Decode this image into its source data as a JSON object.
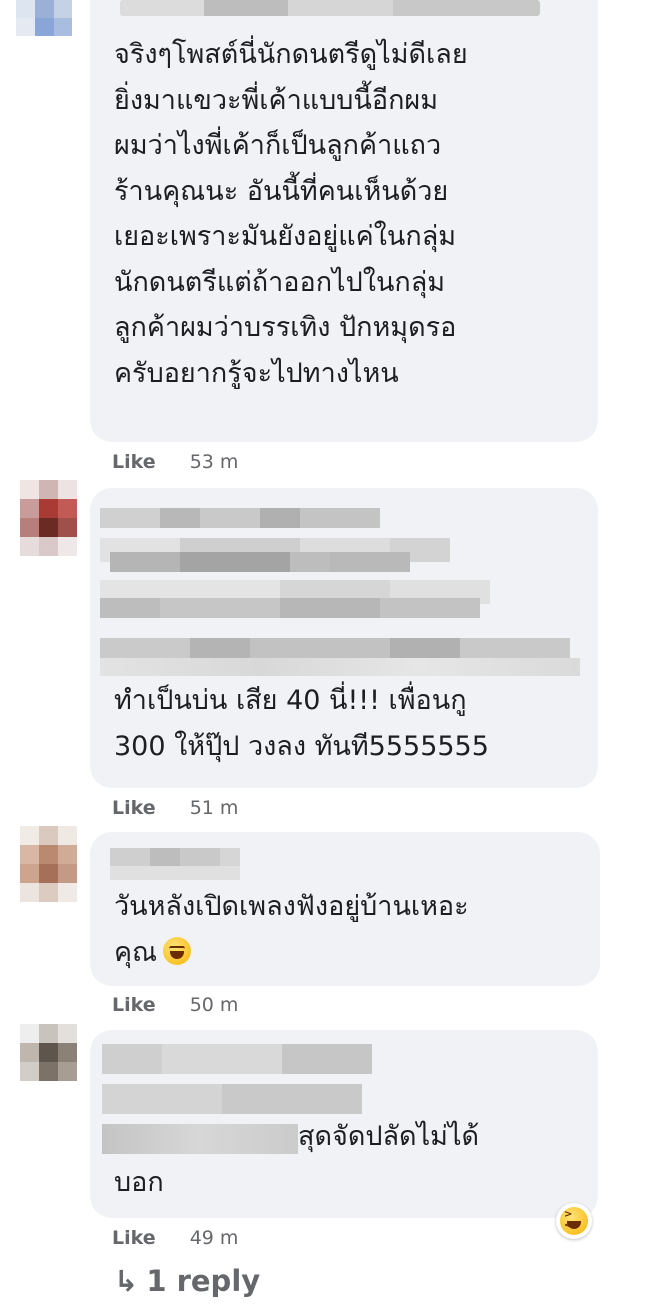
{
  "comments": [
    {
      "lines": "จริงๆโพสต์นี่นักดนตรีดูไม่ดีเลย\nยิ่งมาแขวะพี่เค้าแบบนี้อีกผม\nผมว่าไงพี่เค้าก็เป็นลูกค้าแถว\nร้านคุณนะ อันนี้ที่คนเห็นด้วย\nเยอะเพราะมันยังอยู่แค่ในกลุ่ม\nนักดนตรีแต่ถ้าออกไปในกลุ่ม\nลูกค้าผมว่าบรรเทิง ปักหมุดรอ\nครับอยากรู้จะไปทางไหน",
      "like": "Like",
      "time": "53 m"
    },
    {
      "lines": "ทำเป็นบ่น เสีย 40 นี่!!! เพื่อนกู\n300 ให้ปุ๊ป วงลง ทันที5555555",
      "like": "Like",
      "time": "51 m"
    },
    {
      "lines": "วันหลังเปิดเพลงฟังอยู่บ้านเหอะ\nคุณ",
      "like": "Like",
      "time": "50 m"
    },
    {
      "line1": "สุดจัดปลัดไม่ได้",
      "line2": "บอก",
      "like": "Like",
      "time": "49 m"
    }
  ],
  "reply_link": "1 reply",
  "icons": {
    "reply_arrow": "↳",
    "emoji_inline": "rolling-laughing-emoji",
    "reaction": "laughing-reaction-icon"
  },
  "colors": {
    "bubble": "#f0f2f5",
    "meta": "#65676b"
  }
}
